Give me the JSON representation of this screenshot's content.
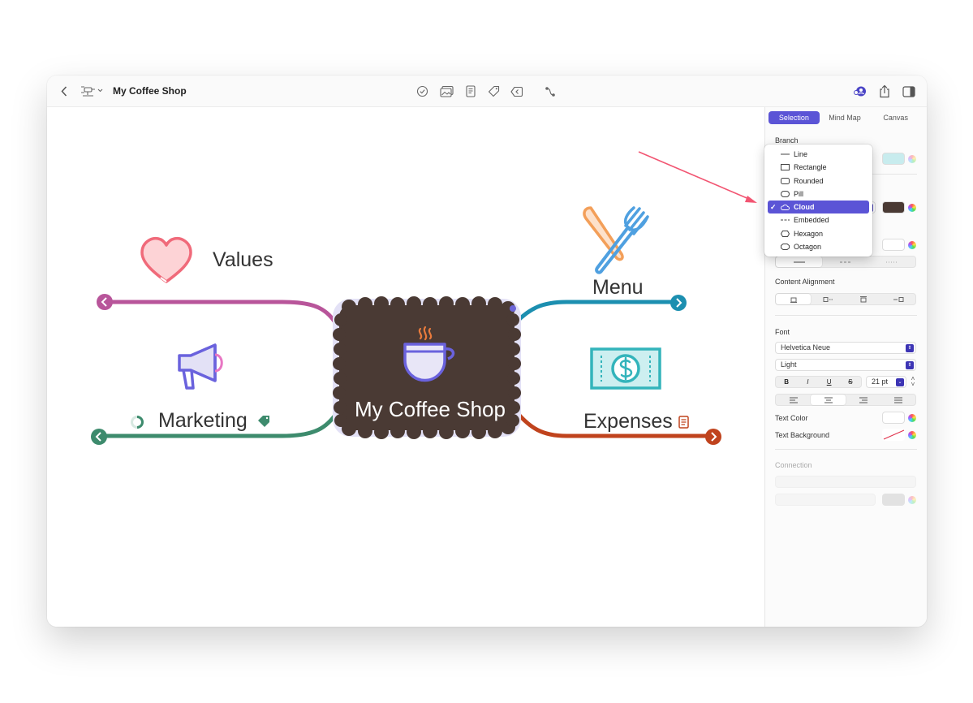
{
  "toolbar": {
    "title": "My Coffee Shop"
  },
  "map": {
    "central_topic": "My Coffee Shop",
    "central_color": "#4a3a34",
    "branches": [
      {
        "label": "Values",
        "color": "#b8559a"
      },
      {
        "label": "Marketing",
        "color": "#3d8b6d"
      },
      {
        "label": "Menu",
        "color": "#1c8fb0"
      },
      {
        "label": "Expenses",
        "color": "#c0431d"
      }
    ]
  },
  "inspector": {
    "tabs": [
      "Selection",
      "Mind Map",
      "Canvas"
    ],
    "active_tab": "Selection",
    "branch_label": "Branch",
    "content_alignment_label": "Content Alignment",
    "font_label": "Font",
    "font_family": "Helvetica Neue",
    "font_weight": "Light",
    "font_style_buttons": [
      "B",
      "I",
      "U",
      "S"
    ],
    "font_size": "21 pt",
    "text_color_label": "Text Color",
    "text_background_label": "Text Background",
    "connection_label": "Connection",
    "branch_fill_color": "#c8ecee",
    "shape_fill_color": "#4a3a34"
  },
  "shape_menu": {
    "items": [
      "Line",
      "Rectangle",
      "Rounded",
      "Pill",
      "Cloud",
      "Embedded",
      "Hexagon",
      "Octagon"
    ],
    "selected": "Cloud",
    "check": "✓"
  },
  "colors": {
    "accent": "#5b54d6",
    "annotation_arrow": "#f25572"
  }
}
